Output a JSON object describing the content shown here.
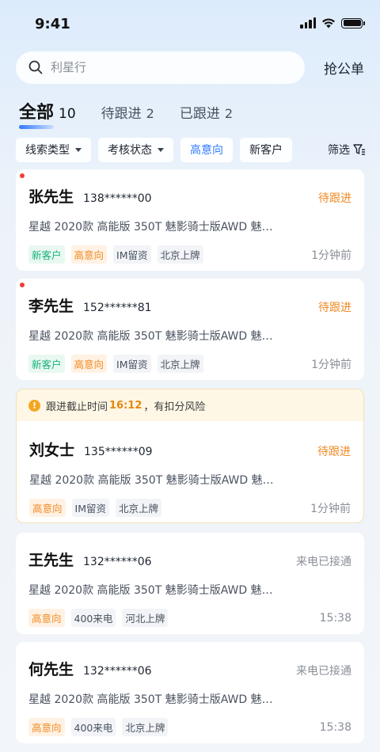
{
  "status_bar": {
    "time": "9:41"
  },
  "search": {
    "placeholder": "利星行"
  },
  "header": {
    "grab_order_label": "抢公单"
  },
  "tabs": [
    {
      "label": "全部",
      "count": "10",
      "active": true
    },
    {
      "label": "待跟进",
      "count": "2",
      "active": false
    },
    {
      "label": "已跟进",
      "count": "2",
      "active": false
    }
  ],
  "filters": {
    "lead_type": "线索类型",
    "review_status": "考核状态",
    "high_intent": "高意向",
    "new_customer": "新客户",
    "filter": "筛选"
  },
  "colors": {
    "accent": "#2f7bff",
    "warning": "#f08a24",
    "unread": "#f23c3c",
    "new_tag": "#16b37a"
  },
  "leads": [
    {
      "name": "张先生",
      "phone": "138******00",
      "status": "待跟进",
      "vehicle": "星越 2020款 高能版 350T 魅影骑士版AWD 魅…",
      "tags": [
        "新客户",
        "高意向",
        "IM留资",
        "北京上牌"
      ],
      "time": "1分钟前",
      "unread": true
    },
    {
      "name": "李先生",
      "phone": "152******81",
      "status": "待跟进",
      "vehicle": "星越 2020款 高能版 350T 魅影骑士版AWD 魅…",
      "tags": [
        "新客户",
        "高意向",
        "IM留资",
        "北京上牌"
      ],
      "time": "1分钟前",
      "unread": true
    },
    {
      "warning": {
        "prefix": "跟进截止时间",
        "time": "16:12",
        "suffix": "，有扣分风险"
      },
      "name": "刘女士",
      "phone": "135******09",
      "status": "待跟进",
      "vehicle": "星越 2020款 高能版 350T 魅影骑士版AWD 魅…",
      "tags": [
        "高意向",
        "IM留资",
        "北京上牌"
      ],
      "time": "1分钟前",
      "unread": false
    },
    {
      "name": "王先生",
      "phone": "132******06",
      "status": "来电已接通",
      "vehicle": "星越 2020款 高能版 350T 魅影骑士版AWD 魅…",
      "tags": [
        "高意向",
        "400来电",
        "河北上牌"
      ],
      "time": "15:38",
      "unread": false
    },
    {
      "name": "何先生",
      "phone": "132******06",
      "status": "来电已接通",
      "vehicle": "星越 2020款 高能版 350T 魅影骑士版AWD 魅…",
      "tags": [
        "高意向",
        "400来电",
        "北京上牌"
      ],
      "time": "15:38",
      "unread": false
    }
  ]
}
